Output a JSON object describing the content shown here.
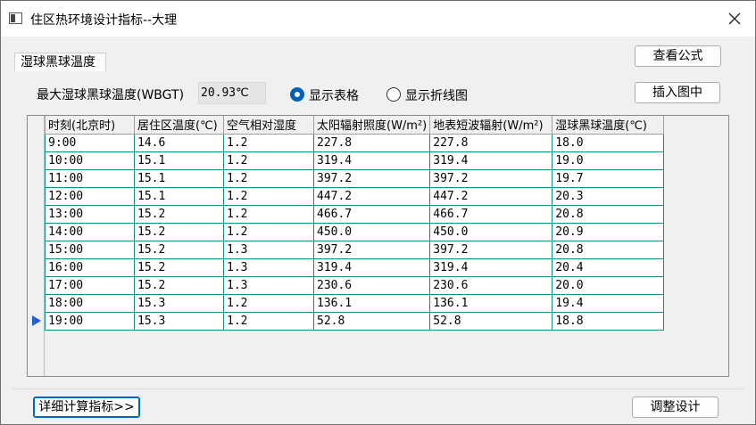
{
  "window": {
    "title": "住区热环境设计指标--大理"
  },
  "tab": {
    "label": "湿球黑球温度"
  },
  "buttons": {
    "view_formula": "查看公式",
    "insert_figure": "插入图中",
    "details": "详细计算指标>>",
    "adjust_design": "调整设计"
  },
  "summary": {
    "label": "最大湿球黑球温度(WBGT)",
    "value": "20.93℃"
  },
  "display_mode": {
    "options": [
      "显示表格",
      "显示折线图"
    ],
    "selected": "显示表格"
  },
  "table": {
    "columns": [
      "时刻(北京时)",
      "居住区温度(℃)",
      "空气相对湿度",
      "太阳辐射照度(W/m²)",
      "地表短波辐射(W/m²)",
      "湿球黑球温度(℃)"
    ],
    "rows": [
      [
        "9:00",
        "14.6",
        "1.2",
        "227.8",
        "227.8",
        "18.0"
      ],
      [
        "10:00",
        "15.1",
        "1.2",
        "319.4",
        "319.4",
        "19.0"
      ],
      [
        "11:00",
        "15.1",
        "1.2",
        "397.2",
        "397.2",
        "19.7"
      ],
      [
        "12:00",
        "15.1",
        "1.2",
        "447.2",
        "447.2",
        "20.3"
      ],
      [
        "13:00",
        "15.2",
        "1.2",
        "466.7",
        "466.7",
        "20.8"
      ],
      [
        "14:00",
        "15.2",
        "1.2",
        "450.0",
        "450.0",
        "20.9"
      ],
      [
        "15:00",
        "15.2",
        "1.3",
        "397.2",
        "397.2",
        "20.8"
      ],
      [
        "16:00",
        "15.2",
        "1.3",
        "319.4",
        "319.4",
        "20.4"
      ],
      [
        "17:00",
        "15.2",
        "1.3",
        "230.6",
        "230.6",
        "20.0"
      ],
      [
        "18:00",
        "15.3",
        "1.2",
        "136.1",
        "136.1",
        "19.4"
      ],
      [
        "19:00",
        "15.3",
        "1.2",
        "52.8",
        "52.8",
        "18.8"
      ]
    ],
    "current_row": 10
  },
  "colors": {
    "grid_line": "#1c8a8a",
    "accent": "#005fb8",
    "row_pointer": "#1f5fd0"
  },
  "icons": {
    "window": "window-icon",
    "close": "close-icon",
    "row_pointer": "triangle-right-icon"
  }
}
